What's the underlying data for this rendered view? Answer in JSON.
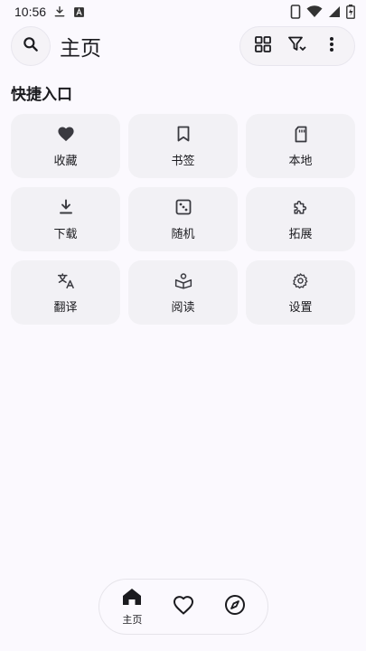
{
  "status_bar": {
    "time": "10:56",
    "icons": [
      "download-notification-icon",
      "app-notification-icon",
      "phone-icon",
      "wifi-icon",
      "signal-icon",
      "battery-icon"
    ]
  },
  "header": {
    "title": "主页",
    "icons": [
      "search-icon",
      "grid-view-icon",
      "filter-icon",
      "more-vertical-icon"
    ]
  },
  "quick_access": {
    "title": "快捷入口",
    "items": [
      {
        "label": "收藏",
        "icon": "heart-icon"
      },
      {
        "label": "书签",
        "icon": "bookmark-icon"
      },
      {
        "label": "本地",
        "icon": "sd-card-icon"
      },
      {
        "label": "下载",
        "icon": "download-icon"
      },
      {
        "label": "随机",
        "icon": "dice-icon"
      },
      {
        "label": "拓展",
        "icon": "puzzle-icon"
      },
      {
        "label": "翻译",
        "icon": "translate-icon"
      },
      {
        "label": "阅读",
        "icon": "reader-icon"
      },
      {
        "label": "设置",
        "icon": "settings-icon"
      }
    ]
  },
  "bottom_nav": {
    "items": [
      {
        "label": "主页",
        "icon": "home-icon",
        "active": true
      },
      {
        "label": "",
        "icon": "heart-outline-icon",
        "active": false
      },
      {
        "label": "",
        "icon": "compass-icon",
        "active": false
      }
    ]
  },
  "colors": {
    "background": "#fbf9fe",
    "tile": "#f2f1f5",
    "icon": "#3a3a40"
  }
}
